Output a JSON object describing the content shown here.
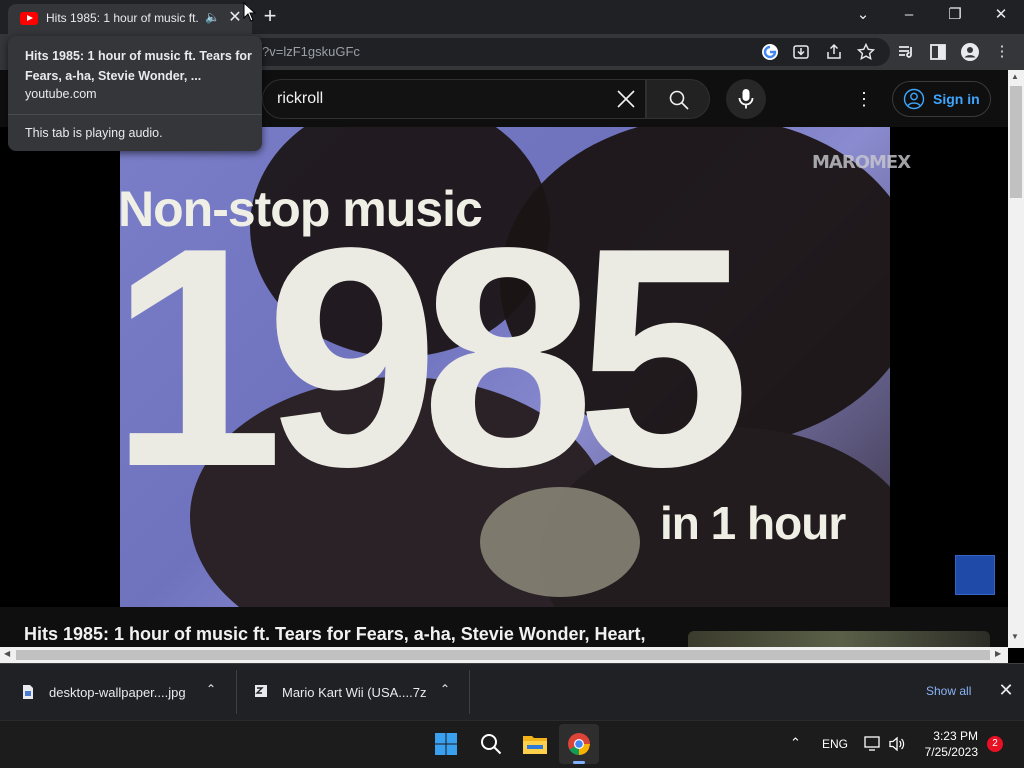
{
  "browser": {
    "tab_title": "Hits 1985: 1 hour of music ft. Tears for Fears, a-ha, Stevie Wonder, Heart,",
    "url": "?v=lzF1gskuGFc",
    "popup": {
      "title": "Hits 1985: 1 hour of music ft. Tears for Fears, a-ha, Stevie Wonder, ...",
      "domain": "youtube.com",
      "audio_status": "This tab is playing audio."
    }
  },
  "youtube": {
    "search_query": "rickroll",
    "sign_in_label": "Sign in"
  },
  "video": {
    "overlay_line1": "Non-stop music",
    "overlay_year": "1985",
    "overlay_line3": "in 1 hour",
    "watermark": "MAROMEX",
    "title": "Hits 1985: 1 hour of music ft. Tears for Fears, a-ha, Stevie Wonder, Heart,"
  },
  "downloads": {
    "items": [
      {
        "name": "desktop-wallpaper....jpg",
        "icon": "image-file-icon"
      },
      {
        "name": "Mario Kart Wii (USA....7z",
        "icon": "archive-file-icon"
      }
    ],
    "show_all_label": "Show all"
  },
  "taskbar": {
    "language": "ENG",
    "time": "3:23 PM",
    "date": "7/25/2023",
    "notification_count": "2"
  },
  "colors": {
    "chrome_dark": "#202124",
    "tab_active": "#35363a",
    "youtube_red": "#ff0000",
    "link_blue": "#3ea6ff",
    "video_blue": "#7a7ec8",
    "taskbar": "#1c1c1c"
  }
}
